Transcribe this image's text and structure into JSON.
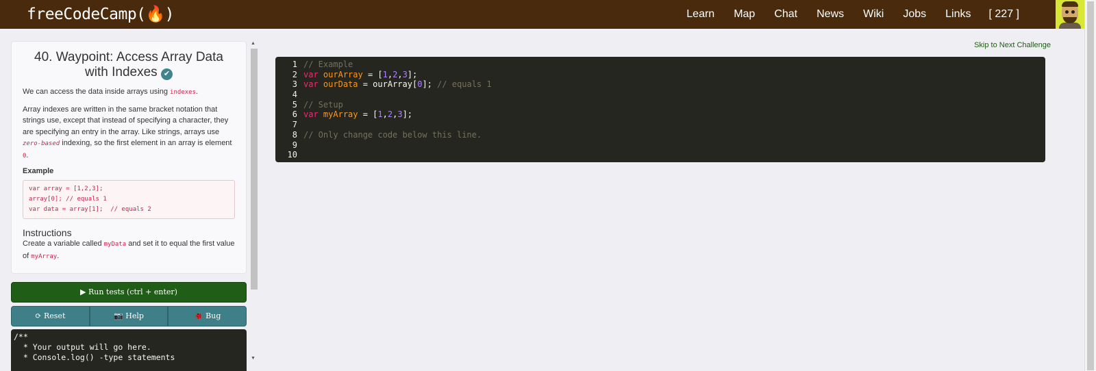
{
  "navbar": {
    "brand": "freeCodeCamp(🔥)",
    "links": [
      "Learn",
      "Map",
      "Chat",
      "News",
      "Wiki",
      "Jobs",
      "Links"
    ],
    "points": "[ 227 ]"
  },
  "challenge": {
    "title": "40. Waypoint: Access Array Data with Indexes",
    "p1_prefix": "We can access the data inside arrays using ",
    "p1_code": "indexes",
    "p1_suffix": ".",
    "p2_part1": "Array indexes are written in the same bracket notation that strings use, except that instead of specifying a character, they are specifying an entry in the array. Like strings, arrays use ",
    "p2_em": "zero-based",
    "p2_part2": " indexing, so the first element in an array is element ",
    "p2_code": "0",
    "p2_end": ".",
    "example_heading": "Example",
    "example_code": "var array = [1,2,3];\narray[0]; // equals 1\nvar data = array[1];  // equals 2",
    "instructions_heading": "Instructions",
    "instr_prefix": "Create a variable called ",
    "instr_code1": "myData",
    "instr_mid": " and set it to equal the first value of ",
    "instr_code2": "myArray",
    "instr_end": "."
  },
  "buttons": {
    "run": "▶  Run tests (ctrl + enter)",
    "reset": "⟳  Reset",
    "help": "📷  Help",
    "bug": "🐞  Bug"
  },
  "console": {
    "text": "/**\n  * Your output will go here.\n  * Console.log() -type statements"
  },
  "skip_link": "Skip to Next Challenge",
  "editor": {
    "line_numbers": [
      "1",
      "2",
      "3",
      "4",
      "5",
      "6",
      "7",
      "8",
      "9",
      "10"
    ]
  }
}
